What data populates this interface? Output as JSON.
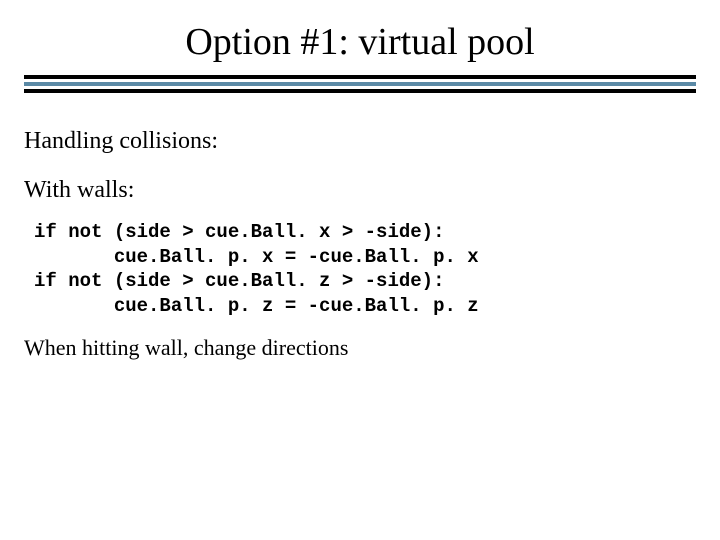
{
  "title": "Option #1:  virtual pool",
  "headings": {
    "collisions": "Handling collisions:",
    "walls": "With walls:"
  },
  "code_lines": [
    "if not (side > cue.Ball. x > -side):",
    "       cue.Ball. p. x = -cue.Ball. p. x",
    "if not (side > cue.Ball. z > -side):",
    "       cue.Ball. p. z = -cue.Ball. p. z"
  ],
  "note": "When hitting wall, change directions"
}
